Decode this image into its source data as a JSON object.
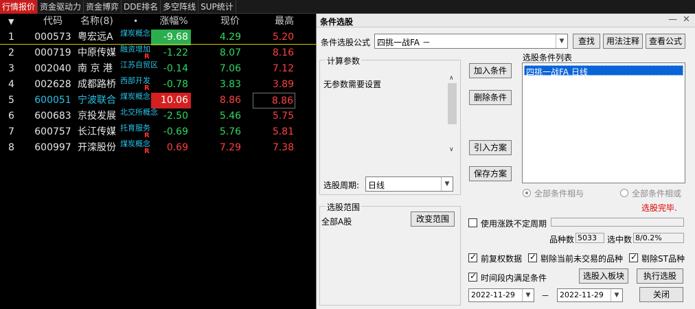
{
  "tabs": [
    "行情报价",
    "资金驱动力",
    "资金博弈",
    "DDE排名",
    "多空阵线",
    "SUP统计"
  ],
  "table": {
    "headers": {
      "idx_icon": "▼",
      "code": "代码",
      "name": "名称(8)",
      "dot": "•",
      "change": "涨幅%",
      "price": "现价",
      "high": "最高"
    },
    "rows": [
      {
        "idx": "1",
        "code": "000573",
        "name": "粤宏远A",
        "tag": "煤炭概念",
        "tag_r": "",
        "change": "-9.68",
        "price": "4.29",
        "high": "5.20"
      },
      {
        "idx": "2",
        "code": "000719",
        "name": "中原传媒",
        "tag": "融资增加",
        "tag_r": "R",
        "change": "-1.22",
        "price": "8.07",
        "high": "8.16"
      },
      {
        "idx": "3",
        "code": "002040",
        "name": "南 京 港",
        "tag": "江苏自贸区",
        "tag_r": "",
        "change": "-0.14",
        "price": "7.06",
        "high": "7.12"
      },
      {
        "idx": "4",
        "code": "002628",
        "name": "成都路桥",
        "tag": "西部开发",
        "tag_r": "R",
        "change": "-0.78",
        "price": "3.83",
        "high": "3.89"
      },
      {
        "idx": "5",
        "code": "600051",
        "name": "宁波联合",
        "tag": "煤炭概念",
        "tag_r": "",
        "change": "10.06",
        "price": "8.86",
        "high": "8.86"
      },
      {
        "idx": "6",
        "code": "600683",
        "name": "京投发展",
        "tag": "北交所概念",
        "tag_r": "",
        "change": "-2.50",
        "price": "5.46",
        "high": "5.75"
      },
      {
        "idx": "7",
        "code": "600757",
        "name": "长江传媒",
        "tag": "托育服务",
        "tag_r": "R",
        "change": "-0.69",
        "price": "5.76",
        "high": "5.81"
      },
      {
        "idx": "8",
        "code": "600997",
        "name": "开滦股份",
        "tag": "煤炭概念",
        "tag_r": "R",
        "change": "0.69",
        "price": "7.29",
        "high": "7.38"
      }
    ]
  },
  "dialog": {
    "title": "条件选股",
    "minimize": "—",
    "close": "✕",
    "formula_label": "条件选股公式",
    "formula_value": "四挑一战FA  －",
    "find_button": "查找",
    "usage_button": "用法注释",
    "view_formula_button": "查看公式",
    "params_legend": "计算参数",
    "params_text": "无参数需要设置",
    "period_label": "选股周期:",
    "period_value": "日线",
    "add_button": "加入条件",
    "delete_button": "删除条件",
    "import_button": "引入方案",
    "save_button": "保存方案",
    "cond_list_label": "选股条件列表",
    "cond_list_item": "四挑一战FA  日线",
    "radio_and": "全部条件相与",
    "radio_or": "全部条件相或",
    "status": "选股完毕.",
    "range_legend": "选股范围",
    "range_value": "全部A股",
    "change_range_button": "改变范围",
    "use_limit_label": "使用涨跌不定周期",
    "variety_label": "品种数",
    "variety_value": "5033",
    "selected_label": "选中数",
    "selected_value": "8/0.2%",
    "pre_adjust_label": "前复权数据",
    "exclude_untraded_label": "剔除当前未交易的品种",
    "exclude_st_label": "剔除ST品种",
    "time_range_label": "时间段内满足条件",
    "to_board_button": "选股入板块",
    "run_button": "执行选股",
    "date_from": "2022-11-29",
    "date_sep": "－",
    "date_to": "2022-11-29",
    "close_button": "关闭"
  },
  "colors": {
    "up": "#ff4040",
    "down": "#30d860",
    "link": "#27c3e8",
    "accent": "#c81c1c"
  }
}
